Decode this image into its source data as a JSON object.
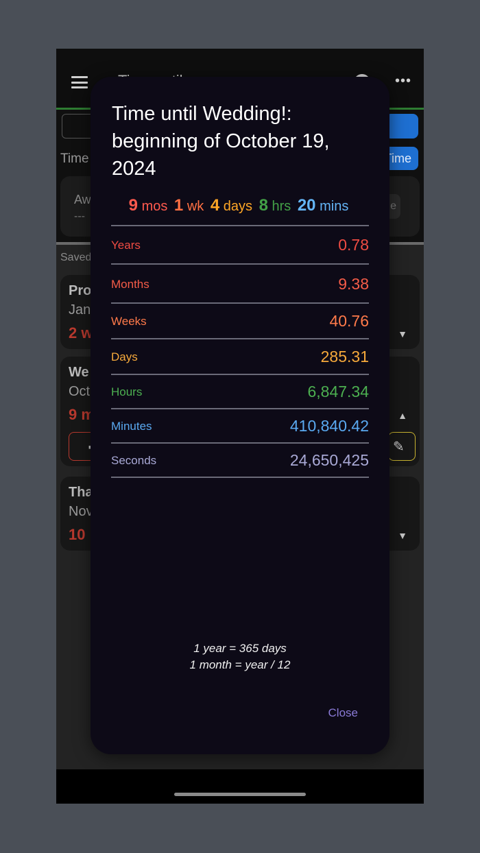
{
  "background_app": {
    "title": "Time until",
    "time_label": "Time",
    "time_button": "Time",
    "await_text": "Aw",
    "dash_text": "---",
    "pill_text": "e",
    "saved_label": "Saved",
    "cards": [
      {
        "name": "Pro",
        "date": "Jan",
        "countdown": "2 w"
      },
      {
        "name": "We",
        "date": "Oct",
        "countdown": "9 m"
      },
      {
        "name": "Tha",
        "date": "Nov",
        "countdown": "10"
      }
    ]
  },
  "modal": {
    "title": "Time until Wedding!: beginning of October 19, 2024",
    "summary": [
      {
        "num": "9",
        "unit": "mos",
        "color": "#ff5a4e"
      },
      {
        "num": "1",
        "unit": "wk",
        "color": "#ff7043"
      },
      {
        "num": "4",
        "unit": "days",
        "color": "#ffa726"
      },
      {
        "num": "8",
        "unit": "hrs",
        "color": "#43a047"
      },
      {
        "num": "20",
        "unit": "mins",
        "color": "#64b5f6"
      }
    ],
    "rows": [
      {
        "label": "Years",
        "value": "0.78",
        "color": "#ef4c43"
      },
      {
        "label": "Months",
        "value": "9.38",
        "color": "#f45c48"
      },
      {
        "label": "Weeks",
        "value": "40.76",
        "color": "#ff7a4a"
      },
      {
        "label": "Days",
        "value": "285.31",
        "color": "#f6a93b"
      },
      {
        "label": "Hours",
        "value": "6,847.34",
        "color": "#4caf50"
      },
      {
        "label": "Minutes",
        "value": "410,840.42",
        "color": "#5aa9f0"
      },
      {
        "label": "Seconds",
        "value": "24,650,425",
        "color": "#a9a9d6"
      }
    ],
    "footnote_1": "1 year = 365 days",
    "footnote_2": "1 month = year / 12",
    "close_label": "Close"
  }
}
